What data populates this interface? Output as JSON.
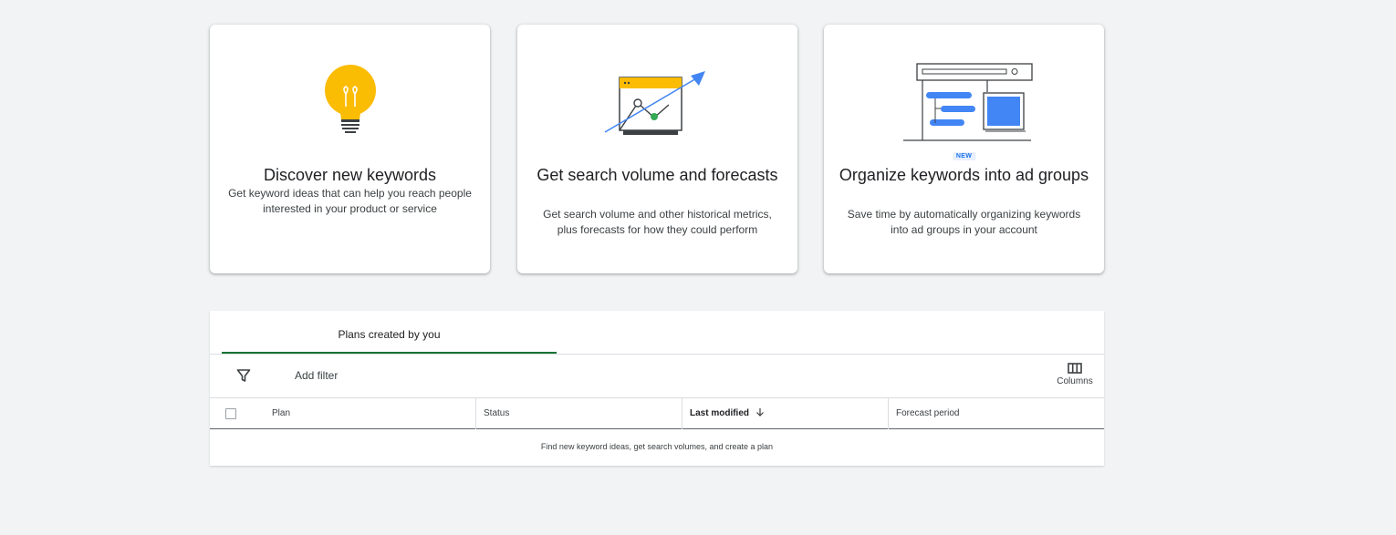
{
  "cards": [
    {
      "title": "Discover new keywords",
      "desc": "Get keyword ideas that can help you reach people interested in your product or service"
    },
    {
      "title": "Get search volume and forecasts",
      "desc": "Get search volume and other historical metrics, plus forecasts for how they could perform"
    },
    {
      "title": "Organize keywords into ad groups",
      "desc": "Save time by automatically organizing keywords into ad groups in your account",
      "badge": "NEW"
    }
  ],
  "plans": {
    "tab_label": "Plans created by you",
    "add_filter": "Add filter",
    "columns_label": "Columns",
    "headers": {
      "plan": "Plan",
      "status": "Status",
      "last_modified": "Last modified",
      "forecast_period": "Forecast period"
    },
    "empty_message": "Find new keyword ideas, get search volumes, and create a plan"
  },
  "icons": {
    "filter": "filter-icon",
    "columns": "columns-icon",
    "sort": "arrow-down-icon",
    "lightbulb": "lightbulb-icon",
    "chart": "chart-icon",
    "organize": "organize-icon"
  },
  "colors": {
    "accent_green": "#137333",
    "bulb_yellow": "#fbbc04",
    "google_blue": "#4285f4",
    "dot_green": "#34a853"
  }
}
